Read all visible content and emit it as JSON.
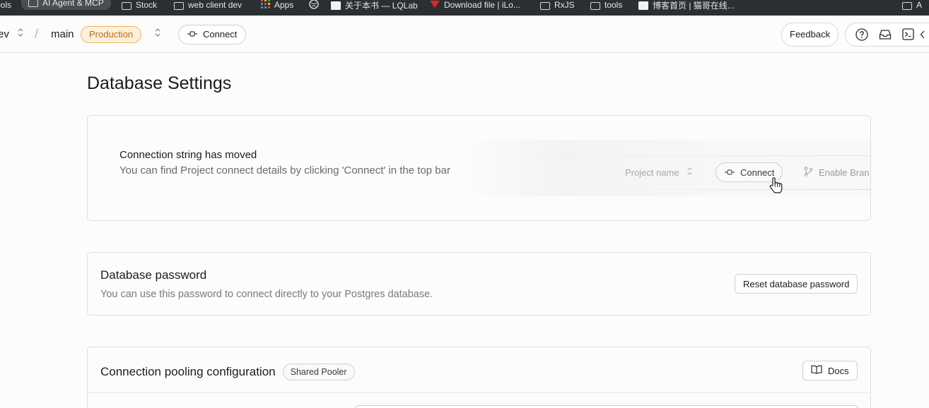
{
  "bookmarks": [
    {
      "label": "ools",
      "icon": "none"
    },
    {
      "label": "AI Agent & MCP",
      "icon": "folder-icon"
    },
    {
      "label": "Stock",
      "icon": "folder-icon"
    },
    {
      "label": "web client dev",
      "icon": "folder-icon"
    },
    {
      "label": "Apps",
      "icon": "apps-grid-icon"
    },
    {
      "label": "",
      "icon": "globe-icon"
    },
    {
      "label": "关于本书 — LQLab",
      "icon": "page-icon"
    },
    {
      "label": "Download file | iLo...",
      "icon": "red-logo-icon"
    },
    {
      "label": "RxJS",
      "icon": "folder-icon"
    },
    {
      "label": "tools",
      "icon": "folder-icon"
    },
    {
      "label": "博客首页 | 猫哥在线...",
      "icon": "page-icon"
    },
    {
      "label": "A",
      "icon": "folder-icon"
    }
  ],
  "header": {
    "project_fragment": "ev",
    "branch": "main",
    "environment_badge": "Production",
    "connect_label": "Connect",
    "feedback_label": "Feedback",
    "icons": [
      "help-icon",
      "inbox-icon",
      "terminal-icon",
      "chevron-left-icon"
    ]
  },
  "page": {
    "title": "Database Settings"
  },
  "connection_notice": {
    "title": "Connection string has moved",
    "description": "You can find Project connect details by clicking 'Connect' in the top bar",
    "illustration": {
      "project_name": "Project name",
      "connect_label": "Connect",
      "branch_label": "Enable Bran"
    }
  },
  "database_password": {
    "title": "Database password",
    "description": "You can use this password to connect directly to your Postgres database.",
    "reset_label": "Reset database password"
  },
  "connection_pooling": {
    "title": "Connection pooling configuration",
    "badge": "Shared Pooler",
    "docs_label": "Docs"
  },
  "colors": {
    "accent_warning_border": "#f0b25a",
    "accent_warning_bg": "#fdf1de",
    "accent_warning_text": "#c2680b",
    "bookmarks_bg": "#2b2f33"
  }
}
